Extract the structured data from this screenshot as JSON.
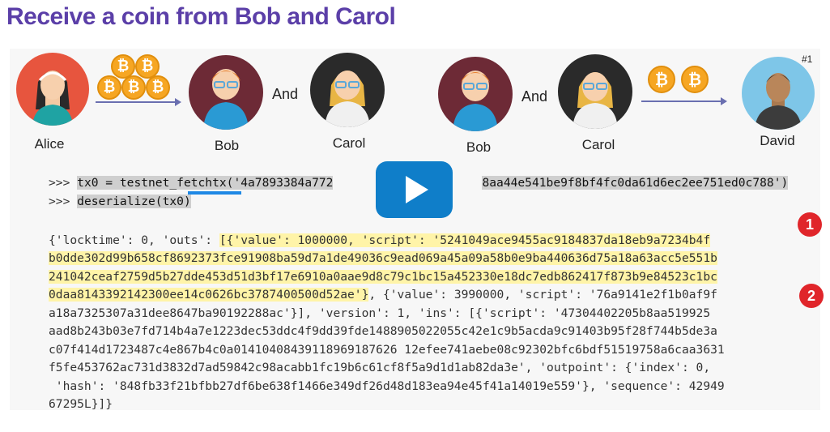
{
  "slide": {
    "title": "Receive a coin from Bob and Carol"
  },
  "diagram": {
    "left": {
      "sender": "Alice",
      "recipients": [
        "Bob",
        "Carol"
      ],
      "joiner": "And",
      "coin_symbol": "₿",
      "coin_count": 5
    },
    "right": {
      "senders": [
        "Bob",
        "Carol"
      ],
      "joiner": "And",
      "recipient": "David",
      "coin_symbol": "₿",
      "coin_count": 2,
      "tag": "#1"
    }
  },
  "console": {
    "prompt": ">>>",
    "cmd1": "tx0 = testnet_fetchtx('4a7893384a772",
    "cmd1_tail": "8aa44e541be9f8bf4fc0da61d6ec2ee751ed0c788')",
    "cmd2": "deserialize(tx0)",
    "out": [
      {
        "pre": "{'locktime': 0, 'outs': ",
        "hl": "[{'value': 1000000, 'script': '5241049ace9455ac9184837da18eb9a7234b4f",
        "post": ""
      },
      {
        "pre": "",
        "hl": "b0dde302d99b658cf8692373fce91908ba59d7a1de49036c9ead069a45a09a58b0e9ba440636d75a18a63acc5e551b",
        "post": ""
      },
      {
        "pre": "",
        "hl": "241042ceaf2759d5b27dde453d51d3bf17e6910a0aae9d8c79c1bc15a452330e18dc7edb862417f873b9e84523c1bc",
        "post": ""
      },
      {
        "pre": "",
        "hl": "0daa8143392142300ee14c0626bc3787400500d52ae'}",
        "post": ", {'value': 3990000, 'script': '76a9141e2f1b0af9f"
      },
      {
        "pre": "a18a7325307a31dee8647ba90192288ac'}], 'version': 1, 'ins': [{'script': '47304402205b8aa519925",
        "hl": "",
        "post": ""
      },
      {
        "pre": "aad8b243b03e7fd714b4a7e1223dec53ddc4f9dd39fde1488905022055c42e1c9b5acda9c91403b95f28f744b5de3a",
        "hl": "",
        "post": ""
      },
      {
        "pre": "c07f414d1723487c4e867b4c0a01410408439118969187626 12efee741aebe08c92302bfc6bdf51519758a6caa3631",
        "hl": "",
        "post": ""
      },
      {
        "pre": "f5fe453762ac731d3832d7ad59842c98acabb1fc19b6c61cf8f5a9d1d1ab82da3e', 'outpoint': {'index': 0,",
        "hl": "",
        "post": ""
      },
      {
        "pre": " 'hash': '848fb33f21bfbb27df6be638f1466e349df26d48d183ea94e45f41a14019e559'}, 'sequence': 42949",
        "hl": "",
        "post": ""
      },
      {
        "pre": "67295L}]}",
        "hl": "",
        "post": ""
      }
    ]
  },
  "badges": [
    "1",
    "2"
  ],
  "video": {
    "state": "paused"
  }
}
